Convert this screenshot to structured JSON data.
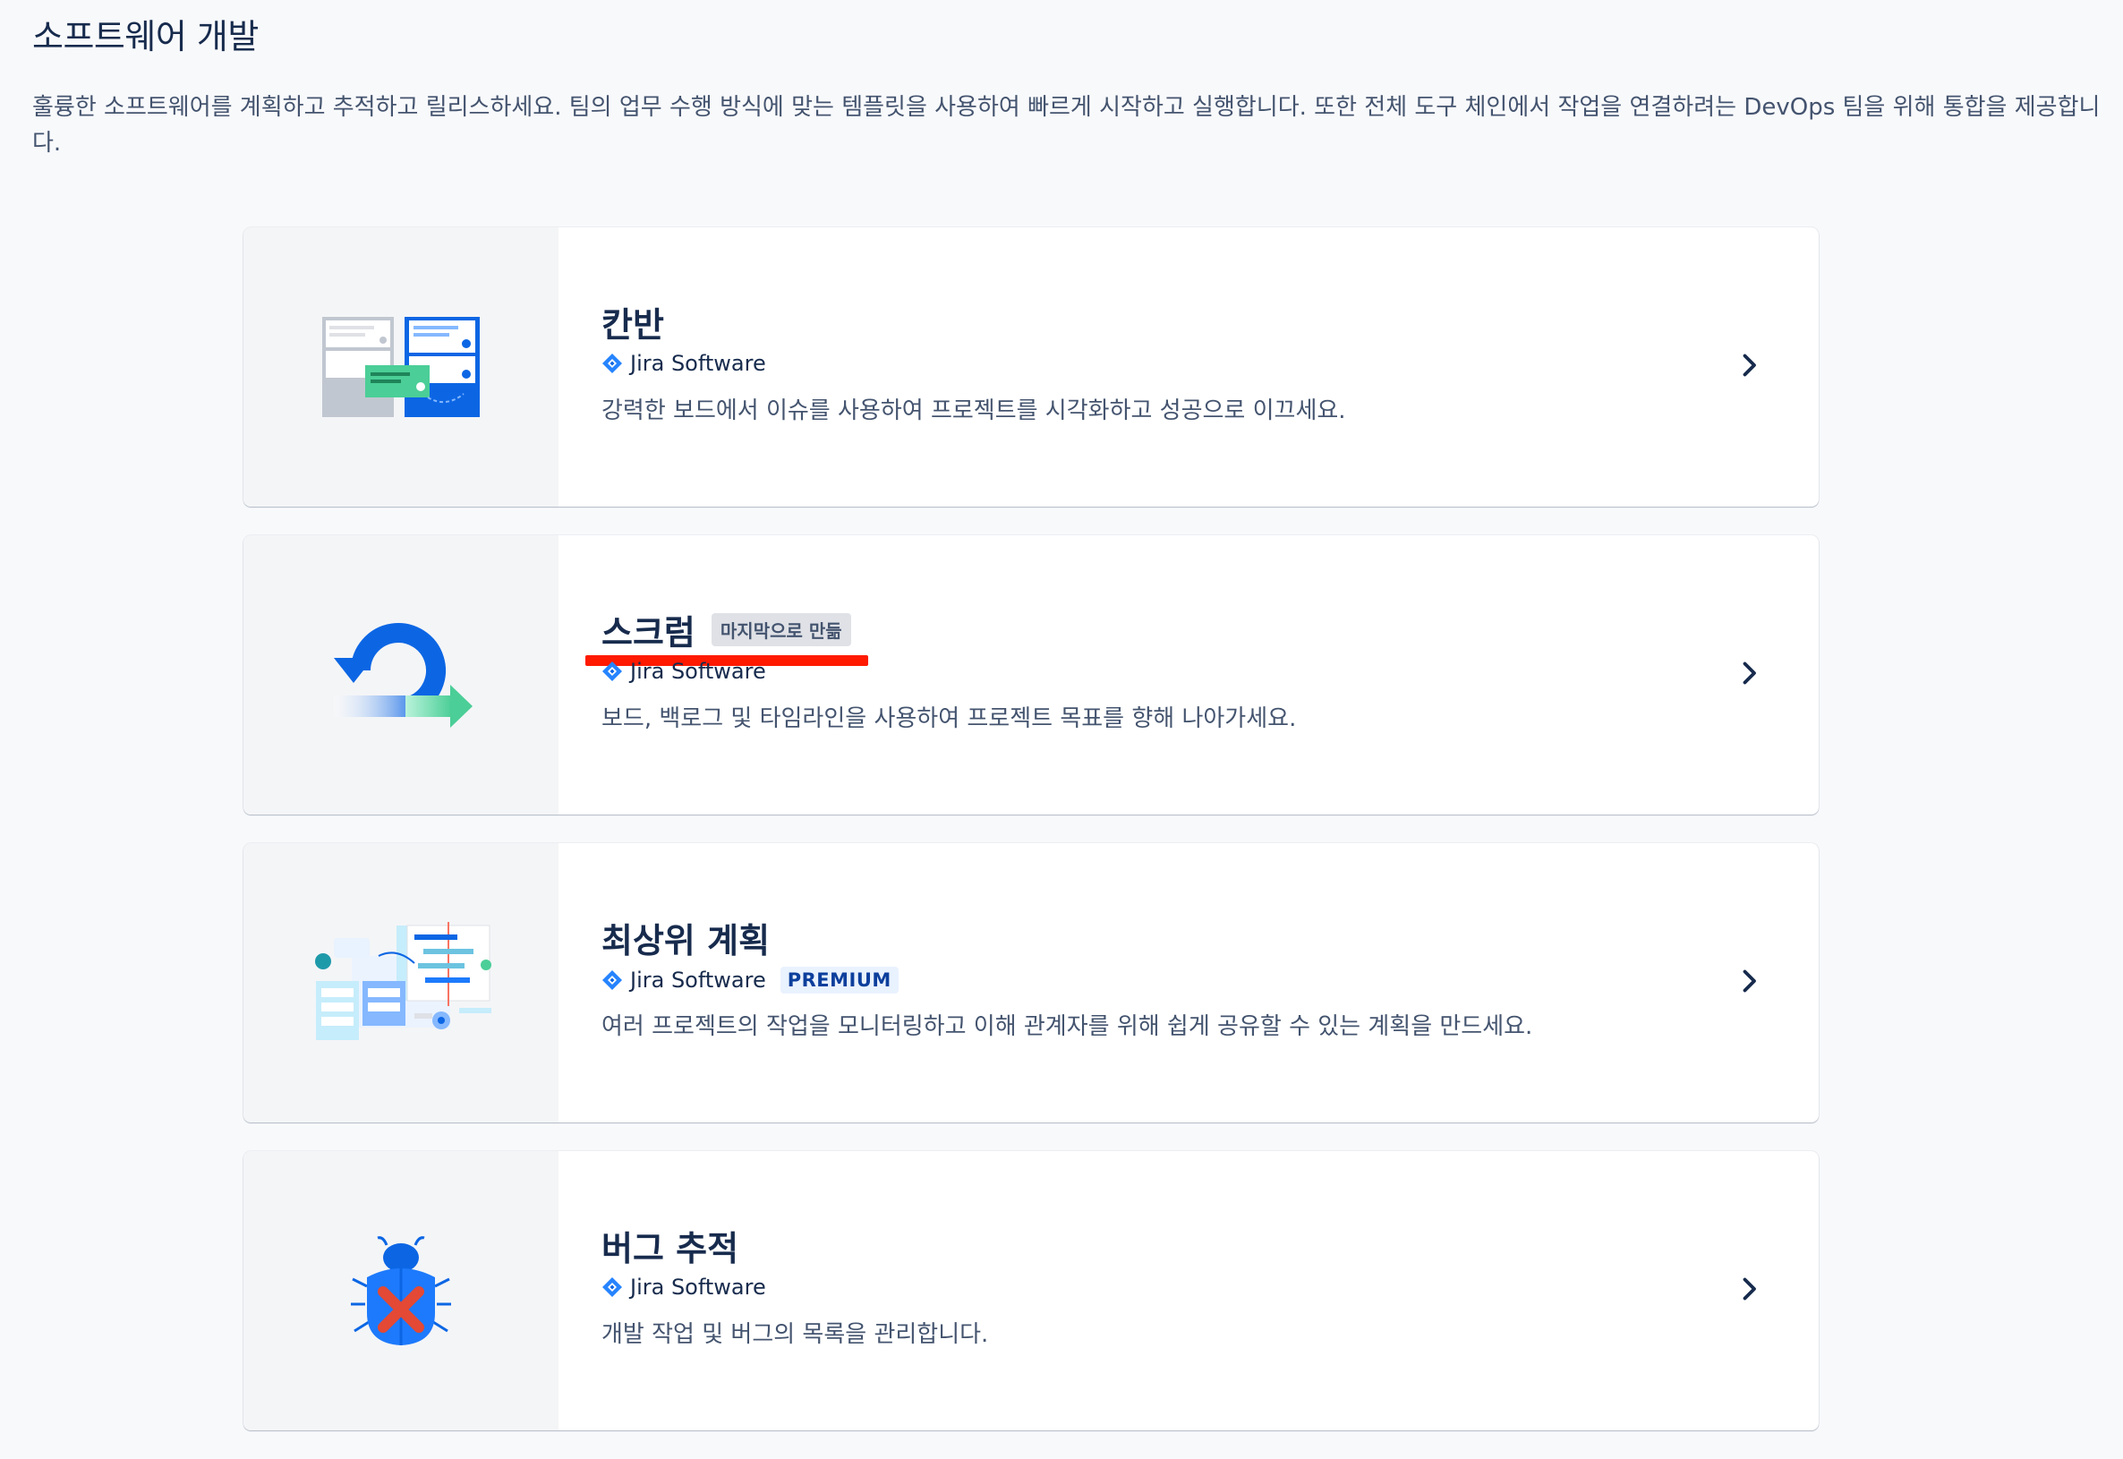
{
  "page": {
    "title": "소프트웨어 개발",
    "description": "훌륭한 소프트웨어를 계획하고 추적하고 릴리스하세요. 팀의 업무 수행 방식에 맞는 템플릿을 사용하여 빠르게 시작하고 실행합니다. 또한 전체 도구 체인에서 작업을 연결하려는 DevOps 팀을 위해 통합을 제공합니다."
  },
  "templates": [
    {
      "title": "칸반",
      "product": "Jira Software",
      "description": "강력한 보드에서 이슈를 사용하여 프로젝트를 시각화하고 성공으로 이끄세요.",
      "illustration": "kanban-board-illustration"
    },
    {
      "title": "스크럼",
      "badge": "마지막으로 만듦",
      "product": "Jira Software",
      "description": "보드, 백로그 및 타임라인을 사용하여 프로젝트 목표를 향해 나아가세요.",
      "illustration": "scrum-cycle-illustration"
    },
    {
      "title": "최상위 계획",
      "product": "Jira Software",
      "badge": "PREMIUM",
      "description": "여러 프로젝트의 작업을 모니터링하고 이해 관계자를 위해 쉽게 공유할 수 있는 계획을 만드세요.",
      "illustration": "top-level-planning-illustration"
    },
    {
      "title": "버그 추적",
      "product": "Jira Software",
      "description": "개발 작업 및 버그의 목록을 관리합니다.",
      "illustration": "bug-tracking-illustration"
    }
  ],
  "colors": {
    "jira_blue": "#0c66e4",
    "jira_blue_light": "#2684ff",
    "green": "#4bce97",
    "annotation_red": "#ff1a00"
  }
}
